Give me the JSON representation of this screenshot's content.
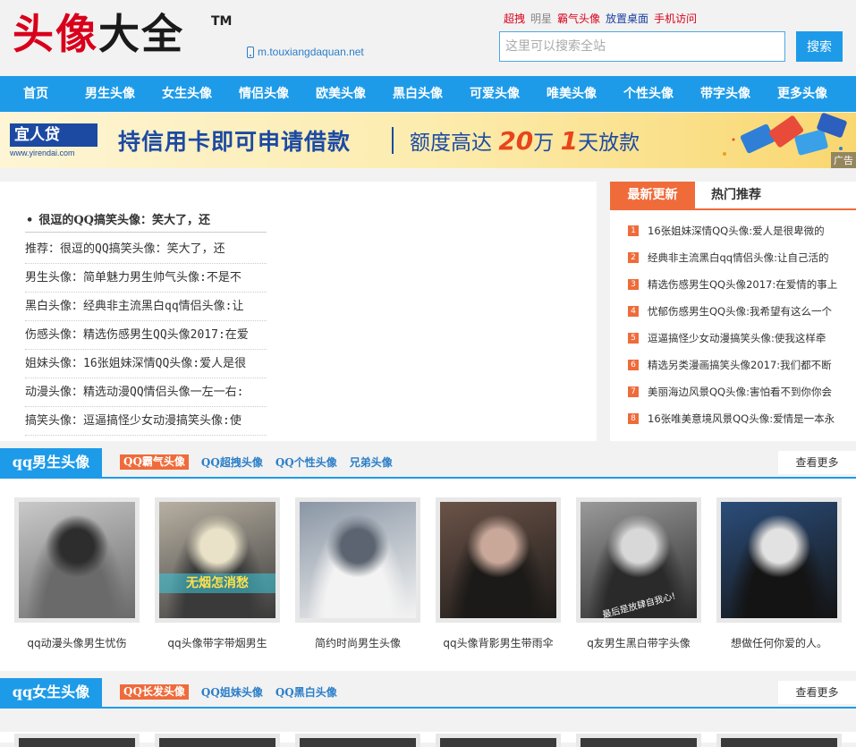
{
  "header": {
    "logo_red1": "头",
    "logo_red2": "像",
    "logo_dark1": "大",
    "logo_dark2": "全",
    "logo_tm": "TM",
    "mobile_url": "m.touxiangdaquan.net",
    "toplinks": [
      {
        "label": "超拽",
        "color": "#d8001b"
      },
      {
        "label": "明星",
        "color": "#888888"
      },
      {
        "label": "霸气头像",
        "color": "#d8001b"
      },
      {
        "label": "放置桌面",
        "color": "#1a3fa0"
      },
      {
        "label": "手机访问",
        "color": "#d8001b"
      }
    ],
    "search_placeholder": "这里可以搜索全站",
    "search_button": "搜索"
  },
  "nav": [
    "首页",
    "男生头像",
    "女生头像",
    "情侣头像",
    "欧美头像",
    "黑白头像",
    "可爱头像",
    "唯美头像",
    "个性头像",
    "带字头像",
    "更多头像"
  ],
  "banner": {
    "brand": "宜人贷",
    "brand_url": "www.yirendai.com",
    "headline": "持信用卡即可申请借款",
    "sub_a": "额度高达",
    "sub_num1": "20",
    "sub_b": "万",
    "sub_num2": "1",
    "sub_c": "天放款",
    "ad_label": "广告"
  },
  "left": {
    "title": "很逗的QQ搞笑头像：笑大了，还",
    "rows": [
      "推荐：很逗的QQ搞笑头像：笑大了，还",
      "男生头像：简单魅力男生帅气头像:不是不",
      "黑白头像：经典非主流黑白qq情侣头像:让",
      "伤感头像：精选伤感男生QQ头像2017:在爱",
      "姐妹头像：16张姐妹深情QQ头像:爱人是很",
      "动漫头像：精选动漫QQ情侣头像一左一右:",
      "搞笑头像：逗逼搞怪少女动漫搞笑头像:使"
    ]
  },
  "right": {
    "tab_active": "最新更新",
    "tab_inactive": "热门推荐",
    "items": [
      {
        "num": "1",
        "text": "16张姐妹深情QQ头像:爱人是很卑微的"
      },
      {
        "num": "2",
        "text": "经典非主流黑白qq情侣头像:让自己活的"
      },
      {
        "num": "3",
        "text": "精选伤感男生QQ头像2017:在爱情的事上"
      },
      {
        "num": "4",
        "text": "忧郁伤感男生QQ头像:我希望有这么一个"
      },
      {
        "num": "5",
        "text": "逗逼搞怪少女动漫搞笑头像:使我这样牵"
      },
      {
        "num": "6",
        "text": "精选另类漫画搞笑头像2017:我们都不断"
      },
      {
        "num": "7",
        "text": "美丽海边风景QQ头像:害怕看不到你你会"
      },
      {
        "num": "8",
        "text": "16张唯美意境风景QQ头像:爱情是一本永"
      }
    ]
  },
  "sections": [
    {
      "title": "qq男生头像",
      "tags": [
        "QQ霸气头像",
        "QQ超拽头像",
        "QQ个性头像",
        "兄弟头像"
      ],
      "more": "查看更多",
      "photos": [
        {
          "caption": "qq动漫头像男生忧伤",
          "colors": [
            "#c9c9c9",
            "#6a6a6a",
            "#2d2d2d"
          ]
        },
        {
          "caption": "qq头像带字带烟男生",
          "colors": [
            "#b8b0a2",
            "#3a3a3a",
            "#e9e2c8"
          ],
          "overlay": "无烟怎消愁"
        },
        {
          "caption": "简约时尚男生头像",
          "colors": [
            "#8a96a5",
            "#f3f3f3",
            "#5b6470"
          ]
        },
        {
          "caption": "qq头像背影男生带雨伞",
          "colors": [
            "#6b5348",
            "#1c1a18",
            "#c9a89a"
          ]
        },
        {
          "caption": "q友男生黑白带字头像",
          "colors": [
            "#9a9a9a",
            "#2a2a2a",
            "#d8d8d8"
          ],
          "overlay": "最后是放肆自我心!"
        },
        {
          "caption": "想做任何你爱的人。",
          "colors": [
            "#2b4d7a",
            "#141414",
            "#e2e2e2"
          ]
        }
      ]
    },
    {
      "title": "qq女生头像",
      "tags": [
        "QQ长发头像",
        "QQ姐妹头像",
        "QQ黑白头像"
      ],
      "more": "查看更多"
    }
  ]
}
